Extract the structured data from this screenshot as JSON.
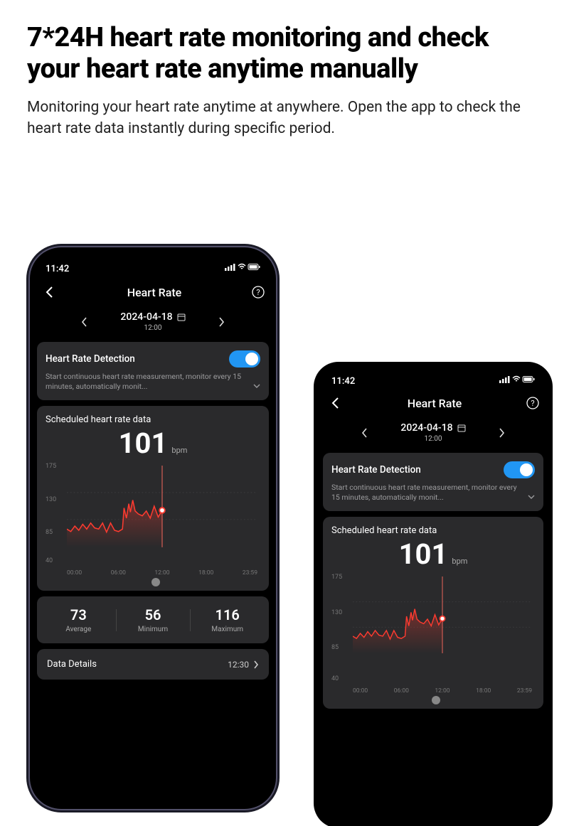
{
  "hero": {
    "title": "7*24H heart rate monitoring and check your heart rate anytime manually",
    "subtitle": "Monitoring your heart rate anytime at anywhere. Open the app to check the heart rate data instantly during specific period."
  },
  "status": {
    "time": "11:42"
  },
  "nav": {
    "title": "Heart Rate"
  },
  "date": {
    "main": "2024-04-18",
    "sub": "12:00"
  },
  "detection": {
    "title": "Heart Rate Detection",
    "desc": "Start continuous heart rate measurement, monitor every 15 minutes, automatically monit...",
    "enabled": true
  },
  "chart_data": {
    "type": "line",
    "title": "Scheduled heart rate data",
    "current_value": 101,
    "unit": "bpm",
    "ylabel": "",
    "xlabel": "",
    "ylim": [
      40,
      175
    ],
    "yticks": [
      175,
      130,
      85,
      40
    ],
    "xticks": [
      "00:00",
      "06:00",
      "12:00",
      "18:00",
      "23:59"
    ],
    "cursor_x": 12.0,
    "series": [
      {
        "name": "hr",
        "x": [
          0.0,
          0.5,
          1.0,
          1.5,
          2.0,
          2.5,
          3.0,
          3.5,
          4.0,
          4.5,
          5.0,
          5.5,
          6.0,
          6.5,
          7.0,
          7.2,
          7.5,
          7.8,
          8.0,
          8.3,
          8.6,
          9.0,
          9.5,
          10.0,
          10.5,
          11.0,
          11.5,
          12.0
        ],
        "y": [
          70,
          66,
          75,
          68,
          78,
          70,
          80,
          72,
          70,
          80,
          65,
          80,
          68,
          66,
          70,
          105,
          88,
          112,
          98,
          118,
          100,
          95,
          92,
          100,
          88,
          108,
          90,
          101
        ]
      }
    ]
  },
  "stats": {
    "average": {
      "value": 73,
      "label": "Average"
    },
    "minimum": {
      "value": 56,
      "label": "Minimum"
    },
    "maximum": {
      "value": 116,
      "label": "Maximum"
    }
  },
  "details": {
    "label": "Data Details",
    "time": "12:30"
  }
}
